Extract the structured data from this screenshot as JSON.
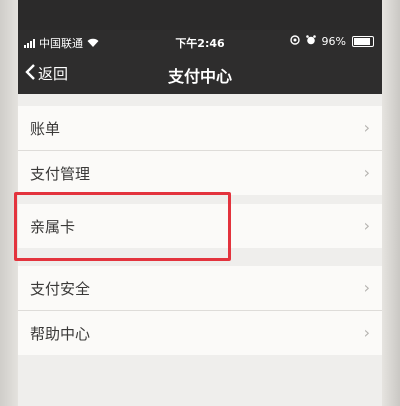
{
  "status_bar": {
    "carrier": "中国联通",
    "time": "下午2:46",
    "battery": "96%"
  },
  "nav": {
    "back_label": "返回",
    "title": "支付中心"
  },
  "menu_groups": [
    {
      "items": [
        {
          "label": "账单"
        },
        {
          "label": "支付管理"
        }
      ]
    },
    {
      "items": [
        {
          "label": "亲属卡"
        }
      ]
    },
    {
      "items": [
        {
          "label": "支付安全"
        },
        {
          "label": "帮助中心"
        }
      ]
    }
  ],
  "colors": {
    "highlight": "#e3333d",
    "nav_bg": "#2e2d2d"
  }
}
